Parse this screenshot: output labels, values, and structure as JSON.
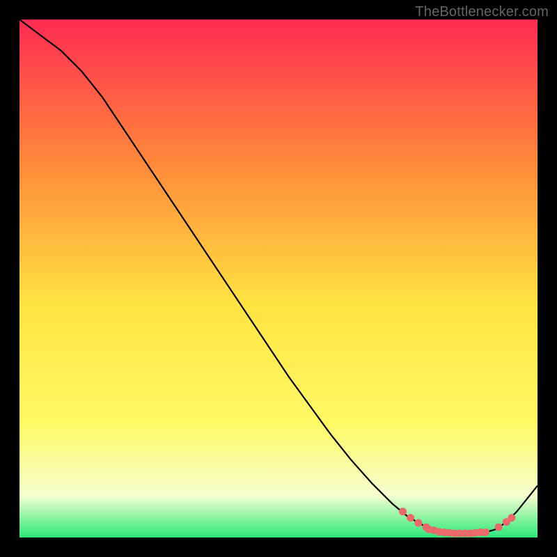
{
  "watermark": "TheBottlenecker.com",
  "colors": {
    "bg": "#000000",
    "grad_top": "#ff2b53",
    "grad_mid_upper": "#ff8a3a",
    "grad_mid": "#ffe341",
    "grad_mid_lower": "#fffa66",
    "grad_band": "#f4ffd0",
    "grad_bottom": "#2ce87a",
    "curve": "#000000",
    "dots": "#e86a6a"
  },
  "chart_data": {
    "type": "line",
    "title": "",
    "xlabel": "",
    "ylabel": "",
    "xlim": [
      0,
      100
    ],
    "ylim": [
      0,
      100
    ],
    "series": [
      {
        "name": "curve",
        "x": [
          0,
          4,
          8,
          12,
          16,
          20,
          24,
          28,
          32,
          36,
          40,
          44,
          48,
          52,
          56,
          60,
          64,
          68,
          72,
          75,
          78,
          80,
          82,
          84,
          86,
          88,
          90,
          92,
          94,
          96,
          100
        ],
        "y": [
          100,
          97,
          94,
          90,
          85,
          79,
          73,
          67,
          61,
          55,
          49,
          43,
          37,
          31,
          25.5,
          20,
          15,
          10.5,
          6.5,
          4,
          2.3,
          1.5,
          1,
          0.8,
          0.7,
          0.8,
          1,
          1.6,
          3,
          5,
          10
        ]
      }
    ],
    "dots": [
      {
        "x": 74,
        "y": 5.0
      },
      {
        "x": 75.5,
        "y": 3.8
      },
      {
        "x": 77,
        "y": 2.8
      },
      {
        "x": 78.5,
        "y": 2.0
      },
      {
        "x": 79,
        "y": 1.6
      },
      {
        "x": 80,
        "y": 1.4
      },
      {
        "x": 81,
        "y": 1.1
      },
      {
        "x": 82,
        "y": 1.0
      },
      {
        "x": 83,
        "y": 0.9
      },
      {
        "x": 84,
        "y": 0.8
      },
      {
        "x": 85,
        "y": 0.8
      },
      {
        "x": 86,
        "y": 0.8
      },
      {
        "x": 87,
        "y": 0.8
      },
      {
        "x": 88,
        "y": 0.9
      },
      {
        "x": 89,
        "y": 1.0
      },
      {
        "x": 90,
        "y": 1.0
      },
      {
        "x": 92.5,
        "y": 2.0
      },
      {
        "x": 94,
        "y": 3.0
      },
      {
        "x": 95,
        "y": 3.8
      }
    ]
  }
}
